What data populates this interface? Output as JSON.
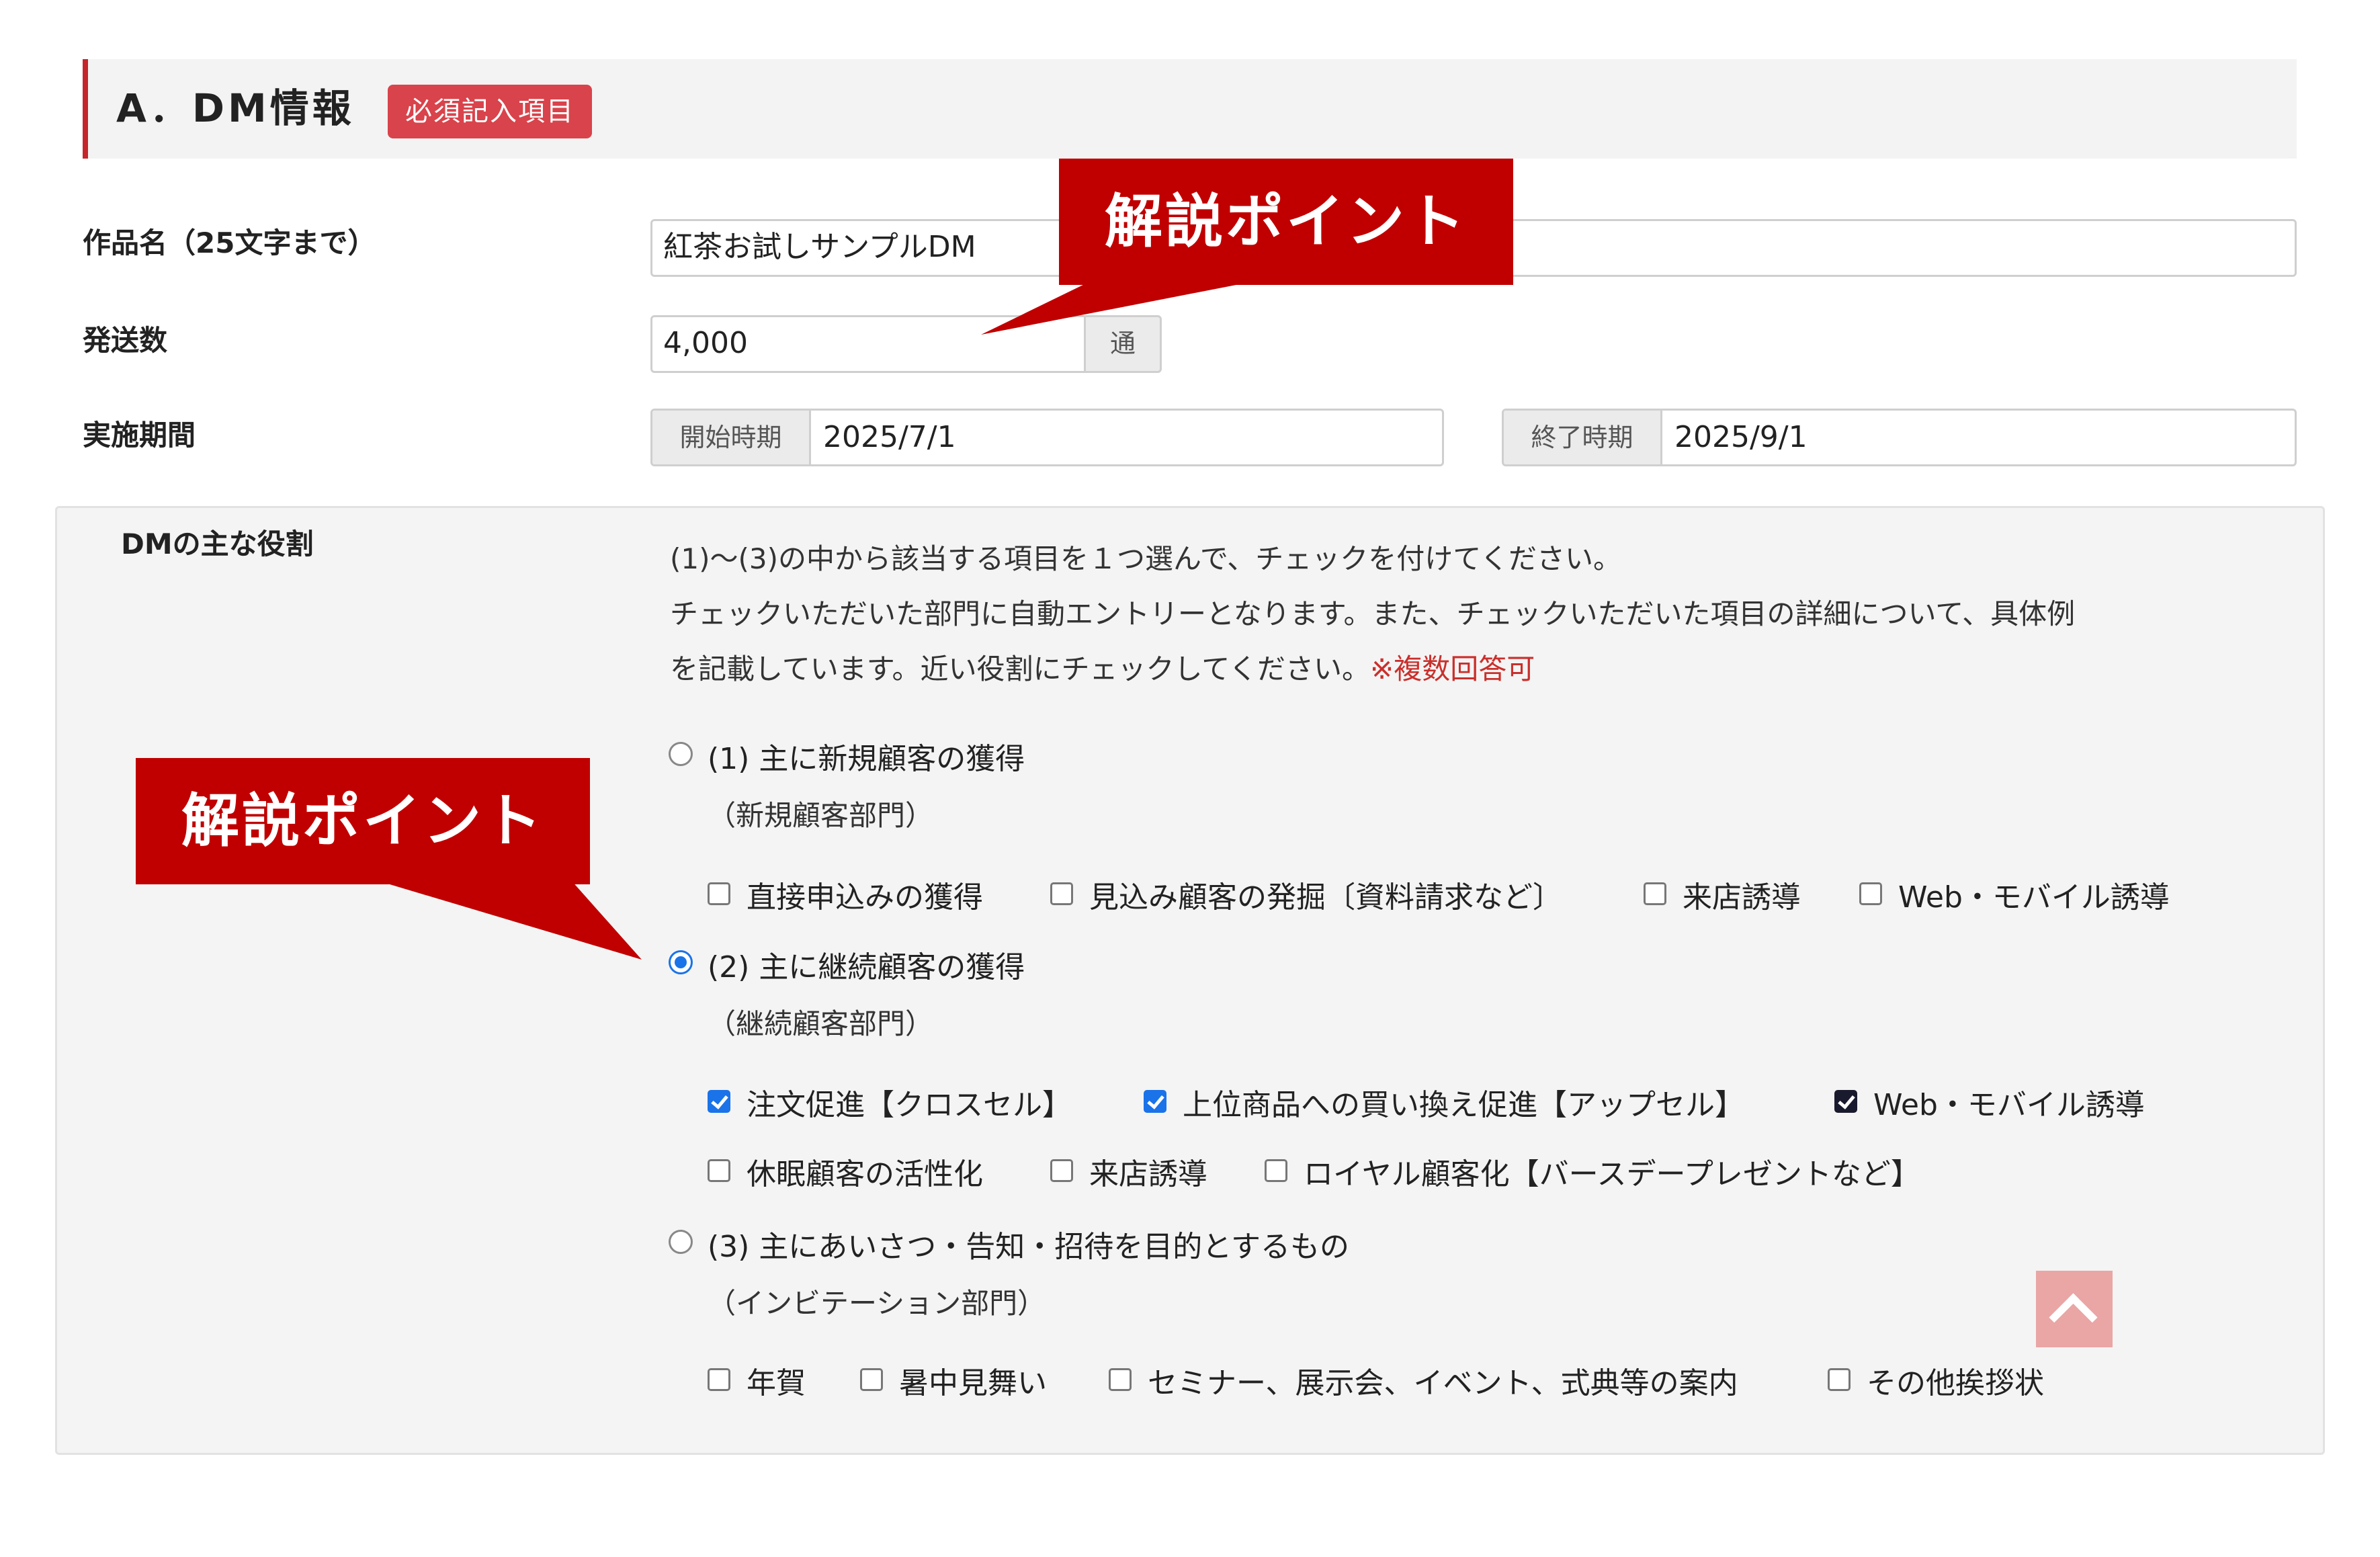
{
  "section": {
    "title": "A．DM情報",
    "required_badge": "必須記入項目",
    "accent_color": "#c5252b"
  },
  "fields": {
    "work_name": {
      "label": "作品名（25文字まで）",
      "value": "紅茶お試しサンプルDM"
    },
    "quantity": {
      "label": "発送数",
      "value": "4,000",
      "unit": "通"
    },
    "period": {
      "label": "実施期間",
      "start_label": "開始時期",
      "start_value": "2025/7/1",
      "end_label": "終了時期",
      "end_value": "2025/9/1"
    }
  },
  "role": {
    "label": "DMの主な役割",
    "intro_line1": "(1)～(3)の中から該当する項目を１つ選んで、チェックを付けてください。",
    "intro_line2": "チェックいただいた部門に自動エントリーとなります。また、チェックいただいた項目の詳細について、具体例",
    "intro_line3": "を記載しています。近い役割にチェックしてください。",
    "intro_note": "※複数回答可",
    "options": [
      {
        "label": "(1) 主に新規顧客の獲得",
        "department": "（新規顧客部門）",
        "selected": false,
        "items": [
          {
            "label": "直接申込みの獲得",
            "checked": false
          },
          {
            "label": "見込み顧客の発掘〔資料請求など〕",
            "checked": false
          },
          {
            "label": "来店誘導",
            "checked": false
          },
          {
            "label": "Web・モバイル誘導",
            "checked": false
          }
        ]
      },
      {
        "label": "(2) 主に継続顧客の獲得",
        "department": "（継続顧客部門）",
        "selected": true,
        "items": [
          {
            "label": "注文促進【クロスセル】",
            "checked": true
          },
          {
            "label": "上位商品への買い換え促進【アップセル】",
            "checked": true
          },
          {
            "label": "Web・モバイル誘導",
            "checked": true
          },
          {
            "label": "休眠顧客の活性化",
            "checked": false
          },
          {
            "label": "来店誘導",
            "checked": false
          },
          {
            "label": "ロイヤル顧客化【バースデープレゼントなど】",
            "checked": false
          }
        ]
      },
      {
        "label": "(3) 主にあいさつ・告知・招待を目的とするもの",
        "department": "（インビテーション部門）",
        "selected": false,
        "items": [
          {
            "label": "年賀",
            "checked": false
          },
          {
            "label": "暑中見舞い",
            "checked": false
          },
          {
            "label": "セミナー、展示会、イベント、式典等の案内",
            "checked": false
          },
          {
            "label": "その他挨拶状",
            "checked": false
          }
        ]
      }
    ]
  },
  "callouts": {
    "top": "解説ポイント",
    "left": "解説ポイント",
    "color": "#c00000"
  },
  "back_to_top": {
    "icon": "chevron-up-icon"
  }
}
